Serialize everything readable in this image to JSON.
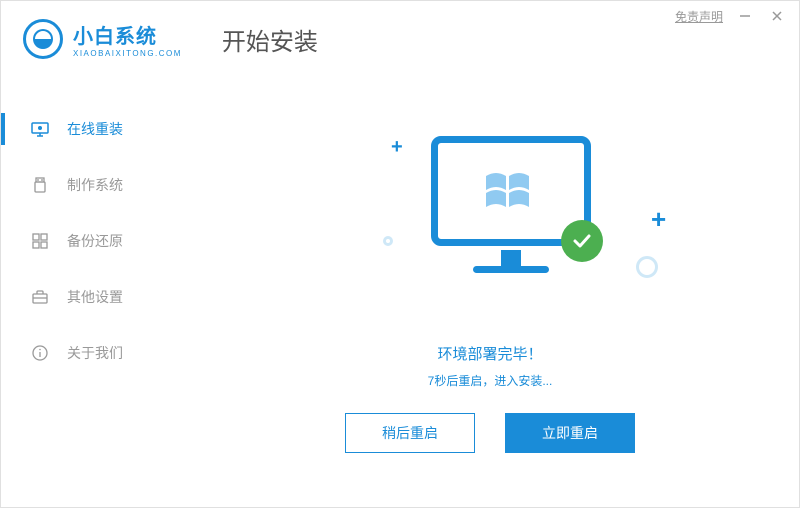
{
  "titlebar": {
    "disclaimer": "免责声明"
  },
  "brand": {
    "name": "小白系统",
    "sub": "XIAOBAIXITONG.COM"
  },
  "page_title": "开始安装",
  "sidebar": {
    "items": [
      {
        "label": "在线重装"
      },
      {
        "label": "制作系统"
      },
      {
        "label": "备份还原"
      },
      {
        "label": "其他设置"
      },
      {
        "label": "关于我们"
      }
    ]
  },
  "status": {
    "title": "环境部署完毕！",
    "sub": "7秒后重启，进入安装..."
  },
  "buttons": {
    "later": "稍后重启",
    "now": "立即重启"
  }
}
